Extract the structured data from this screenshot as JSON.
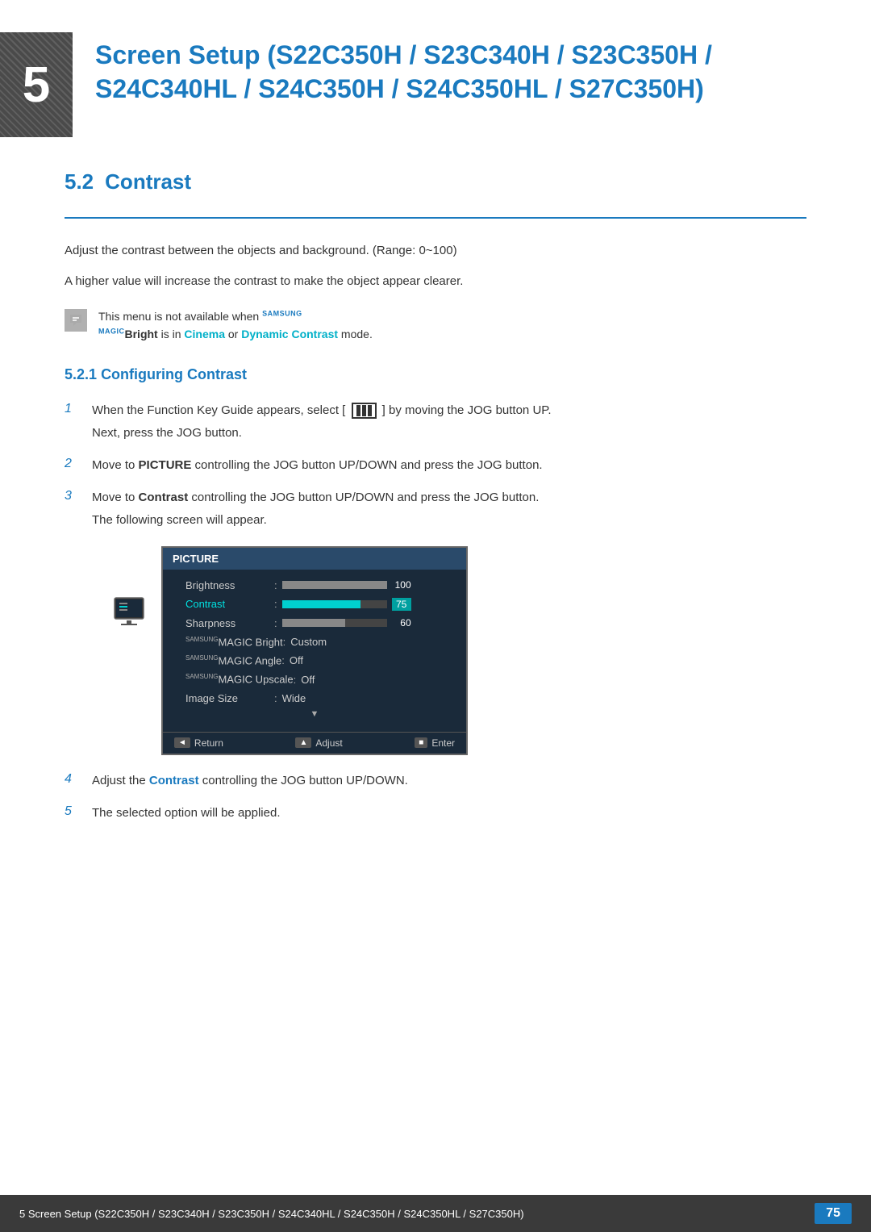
{
  "chapter": {
    "number": "5",
    "title": "Screen Setup (S22C350H / S23C340H / S23C350H / S24C340HL / S24C350H / S24C350HL / S27C350H)",
    "section_number": "5.2",
    "section_title": "Contrast",
    "divider": true
  },
  "descriptions": [
    "Adjust the contrast between the objects and background. (Range: 0~100)",
    "A higher value will increase the contrast to make the object appear clearer."
  ],
  "note": {
    "text_before": "This menu is not available when ",
    "brand": "SAMSUNG MAGIC",
    "bold": "Bright",
    "text_middle": " is in ",
    "highlight1": "Cinema",
    "text_or": " or ",
    "highlight2": "Dynamic Contrast",
    "text_after": " mode."
  },
  "subsection": {
    "number": "5.2.1",
    "title": "Configuring Contrast"
  },
  "steps": [
    {
      "number": "1",
      "text": "When the Function Key Guide appears, select [",
      "icon": "jog",
      "text2": "] by moving the JOG button UP.",
      "sub": "Next, press the JOG button."
    },
    {
      "number": "2",
      "text": "Move to ",
      "bold": "PICTURE",
      "text2": " controlling the JOG button UP/DOWN and press the JOG button."
    },
    {
      "number": "3",
      "text": "Move to ",
      "bold": "Contrast",
      "text2": " controlling the JOG button UP/DOWN and press the JOG button.",
      "sub": "The following screen will appear."
    },
    {
      "number": "4",
      "text": "Adjust the ",
      "bold": "Contrast",
      "text2": " controlling the JOG button UP/DOWN."
    },
    {
      "number": "5",
      "text": "The selected option will be applied."
    }
  ],
  "screen": {
    "header": "PICTURE",
    "rows": [
      {
        "label": "Brightness",
        "type": "bar",
        "fill": "full",
        "value": "100",
        "highlight": false
      },
      {
        "label": "Contrast",
        "type": "bar",
        "fill": "75",
        "value": "75",
        "highlight": true
      },
      {
        "label": "Sharpness",
        "type": "bar",
        "fill": "60",
        "value": "60",
        "highlight": false
      },
      {
        "label": "SAMSUNG MAGIC Bright",
        "type": "text",
        "value": "Custom",
        "highlight": false
      },
      {
        "label": "SAMSUNG MAGIC Angle",
        "type": "text",
        "value": "Off",
        "highlight": false
      },
      {
        "label": "SAMSUNG MAGIC Upscale",
        "type": "text",
        "value": "Off",
        "highlight": false
      },
      {
        "label": "Image Size",
        "type": "text",
        "value": "Wide",
        "highlight": false
      }
    ],
    "footer": [
      {
        "icon": "◄",
        "label": "Return"
      },
      {
        "icon": "▲",
        "label": "Adjust"
      },
      {
        "icon": "■",
        "label": "Enter"
      }
    ]
  },
  "footer": {
    "text": "5 Screen Setup (S22C350H / S23C340H / S23C350H / S24C340HL / S24C350H / S24C350HL / S27C350H)",
    "page": "75"
  }
}
